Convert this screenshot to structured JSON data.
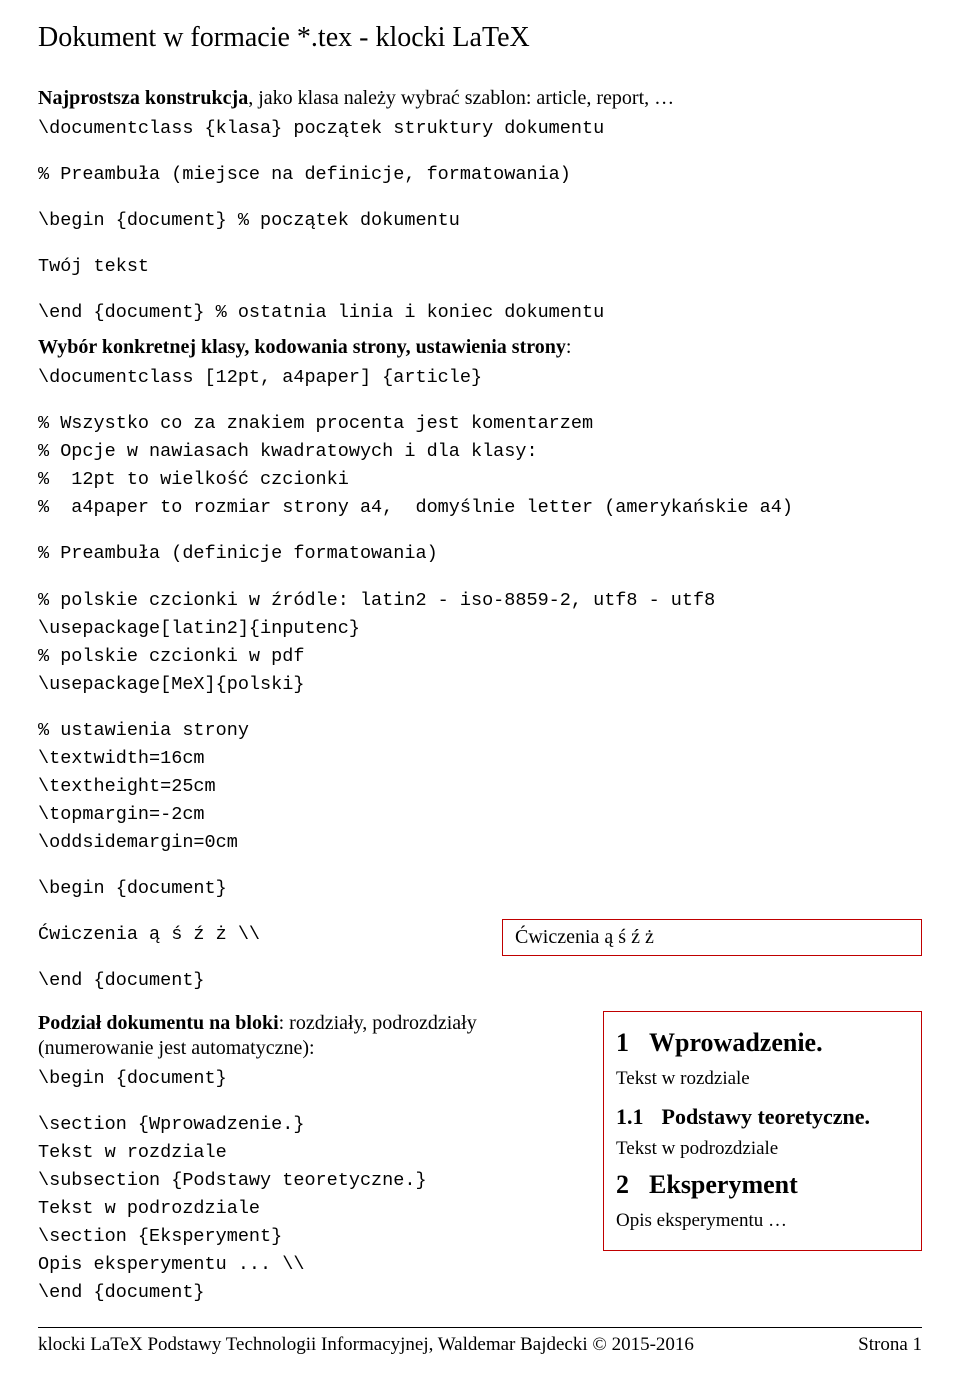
{
  "title": "Dokument w formacie *.tex     - klocki LaTeX",
  "intro_bold": "Najprostsza konstrukcja",
  "intro_rest": ", jako klasa należy wybrać szablon: article, report, …",
  "code1_l1": "\\documentclass {klasa} początek struktury dokumentu",
  "code1_l2": "% Preambuła (miejsce na definicje, formatowania)",
  "code1_l3": "\\begin {document} % początek dokumentu",
  "code1_l4": "Twój tekst",
  "code1_l5": "\\end {document} % ostatnia linia i koniec dokumentu",
  "para2_bold": "Wybór konkretnej klasy, kodowania strony, ustawienia strony",
  "para2_colon": ":",
  "code2_l1": "\\documentclass [12pt, a4paper] {article}",
  "code2_l2": "% Wszystko co za znakiem procenta jest komentarzem",
  "code2_l3": "% Opcje w nawiasach kwadratowych i dla klasy:",
  "code2_l4": "%  12pt to wielkość czcionki",
  "code2_l5": "%  a4paper to rozmiar strony a4,  domyślnie letter (amerykańskie a4)",
  "code2_l6": "% Preambuła (definicje formatowania)",
  "code2_l7": "% polskie czcionki w źródle: latin2 - iso-8859-2, utf8 - utf8",
  "code2_l8": "\\usepackage[latin2]{inputenc}",
  "code2_l9": "% polskie czcionki w pdf",
  "code2_l10": "\\usepackage[MeX]{polski}",
  "code2_l11": "% ustawienia strony",
  "code2_l12": "\\textwidth=16cm",
  "code2_l13": "\\textheight=25cm",
  "code2_l14": "\\topmargin=-2cm",
  "code2_l15": "\\oddsidemargin=0cm",
  "code2_l16": "\\begin {document}",
  "code2_l17": "Ćwiczenia ą ś ź ż \\\\",
  "code2_l18": "\\end {document}",
  "result1_text": "Ćwiczenia ą ś ź ż",
  "para3_bold1": "Podział dokumentu na bloki",
  "para3_rest": ": rozdziały, podrozdziały (numerowanie jest automatyczne):",
  "code3_l1": "\\begin {document}",
  "code3_l2": "\\section {Wprowadzenie.}",
  "code3_l3": "Tekst w rozdziale",
  "code3_l4": "\\subsection {Podstawy teoretyczne.}",
  "code3_l5": "Tekst w podrozdziale",
  "code3_l6": "\\section {Eksperyment}",
  "code3_l7": "Opis eksperymentu ... \\\\",
  "code3_l8": "\\end {document}",
  "result2": {
    "s1_num": "1",
    "s1_title": "Wprowadzenie.",
    "s1_text": "Tekst w rozdziale",
    "s11_num": "1.1",
    "s11_title": "Podstawy teoretyczne.",
    "s11_text": "Tekst w podrozdziale",
    "s2_num": "2",
    "s2_title": "Eksperyment",
    "s2_text": "Opis eksperymentu …"
  },
  "footer": {
    "left": "klocki LaTeX     Podstawy Technologii Informacyjnej, Waldemar Bajdecki © 2015-2016",
    "right": "Strona 1"
  }
}
